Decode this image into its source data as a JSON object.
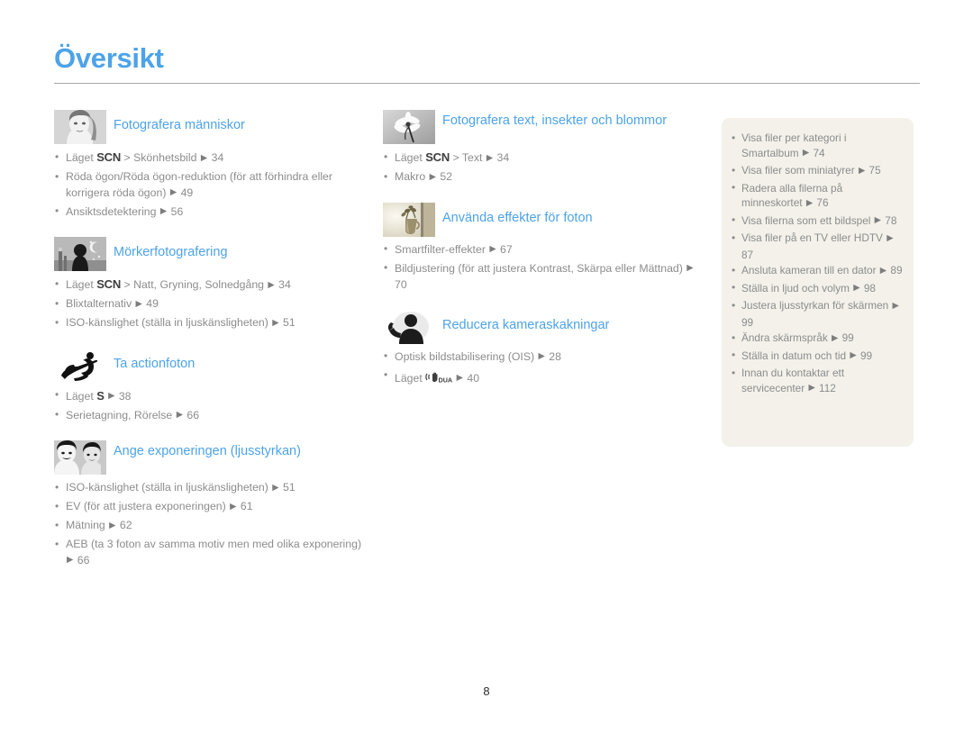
{
  "document": {
    "title": "Översikt",
    "page_number": "8",
    "accent_color": "#4da3e8",
    "body_text_color": "#8c8c8c",
    "sidebar_bg_color": "#f3f1ea"
  },
  "columns": {
    "left": [
      {
        "icon": "portrait-woman-thumbnail",
        "title": "Fotografera människor",
        "items": [
          {
            "prefix": "Läget ",
            "mode": "SCN",
            "text": " > Skönhetsbild ",
            "page": "34"
          },
          {
            "prefix": "",
            "mode": "",
            "text": "Röda ögon/Röda ögon-reduktion (för att förhindra eller korrigera röda ögon) ",
            "page": "49"
          },
          {
            "prefix": "",
            "mode": "",
            "text": "Ansiktsdetektering ",
            "page": "56"
          }
        ]
      },
      {
        "icon": "night-scene-thumbnail",
        "title": "Mörkerfotografering",
        "items": [
          {
            "prefix": "Läget ",
            "mode": "SCN",
            "text": " > Natt, Gryning, Solnedgång ",
            "page": "34"
          },
          {
            "prefix": "",
            "mode": "",
            "text": "Blixtalternativ ",
            "page": "49"
          },
          {
            "prefix": "",
            "mode": "",
            "text": "ISO-känslighet (ställa in ljuskänsligheten) ",
            "page": "51"
          }
        ]
      },
      {
        "icon": "snowboarder-thumbnail",
        "title": "Ta actionfoton",
        "items": [
          {
            "prefix": "Läget ",
            "mode": "S",
            "text": " ",
            "page": "38"
          },
          {
            "prefix": "",
            "mode": "",
            "text": "Serietagning, Rörelse ",
            "page": "66"
          }
        ]
      },
      {
        "icon": "two-faces-thumbnail",
        "title": "Ange exponeringen (ljusstyrkan)",
        "items": [
          {
            "prefix": "",
            "mode": "",
            "text": "ISO-känslighet (ställa in ljuskänsligheten) ",
            "page": "51"
          },
          {
            "prefix": "",
            "mode": "",
            "text": "EV (för att justera exponeringen) ",
            "page": "61"
          },
          {
            "prefix": "",
            "mode": "",
            "text": "Mätning ",
            "page": "62"
          },
          {
            "prefix": "",
            "mode": "",
            "text": "AEB (ta 3 foton av samma motiv men med olika exponering) ",
            "page": "66"
          }
        ]
      }
    ],
    "middle": [
      {
        "icon": "flower-thumbnail",
        "title": "Fotografera text, insekter och blommor",
        "items": [
          {
            "prefix": "Läget ",
            "mode": "SCN",
            "text": " > Text ",
            "page": "34"
          },
          {
            "prefix": "",
            "mode": "",
            "text": "Makro ",
            "page": "52"
          }
        ]
      },
      {
        "icon": "vase-plant-thumbnail",
        "title": "Använda effekter för foton",
        "items": [
          {
            "prefix": "",
            "mode": "",
            "text": "Smartfilter-effekter ",
            "page": "67"
          },
          {
            "prefix": "",
            "mode": "",
            "text": "Bildjustering (för att justera Kontrast, Skärpa eller Mättnad) ",
            "page": "70"
          }
        ]
      },
      {
        "icon": "shaking-person-thumbnail",
        "title": "Reducera kameraskakningar",
        "items": [
          {
            "prefix": "",
            "mode": "",
            "text": "Optisk bildstabilisering (OIS) ",
            "page": "28"
          },
          {
            "prefix": "Läget ",
            "mode": "DUAL-ICON",
            "text": " ",
            "page": "40"
          }
        ]
      }
    ]
  },
  "sidebar": {
    "items": [
      {
        "text": "Visa filer per kategori i Smartalbum ",
        "page": "74"
      },
      {
        "text": "Visa filer som miniatyrer ",
        "page": "75"
      },
      {
        "text": "Radera alla filerna på minneskortet ",
        "page": "76"
      },
      {
        "text": "Visa filerna som ett bildspel ",
        "page": "78"
      },
      {
        "text": "Visa filer på en TV eller HDTV ",
        "page": "87"
      },
      {
        "text": "Ansluta kameran till en dator ",
        "page": "89"
      },
      {
        "text": "Ställa in ljud och volym ",
        "page": "98"
      },
      {
        "text": "Justera ljusstyrkan för skärmen ",
        "page": "99"
      },
      {
        "text": "Ändra skärmspråk ",
        "page": "99"
      },
      {
        "text": "Ställa in datum och tid ",
        "page": "99"
      },
      {
        "text": "Innan du kontaktar ett servicecenter ",
        "page": "112"
      }
    ]
  }
}
